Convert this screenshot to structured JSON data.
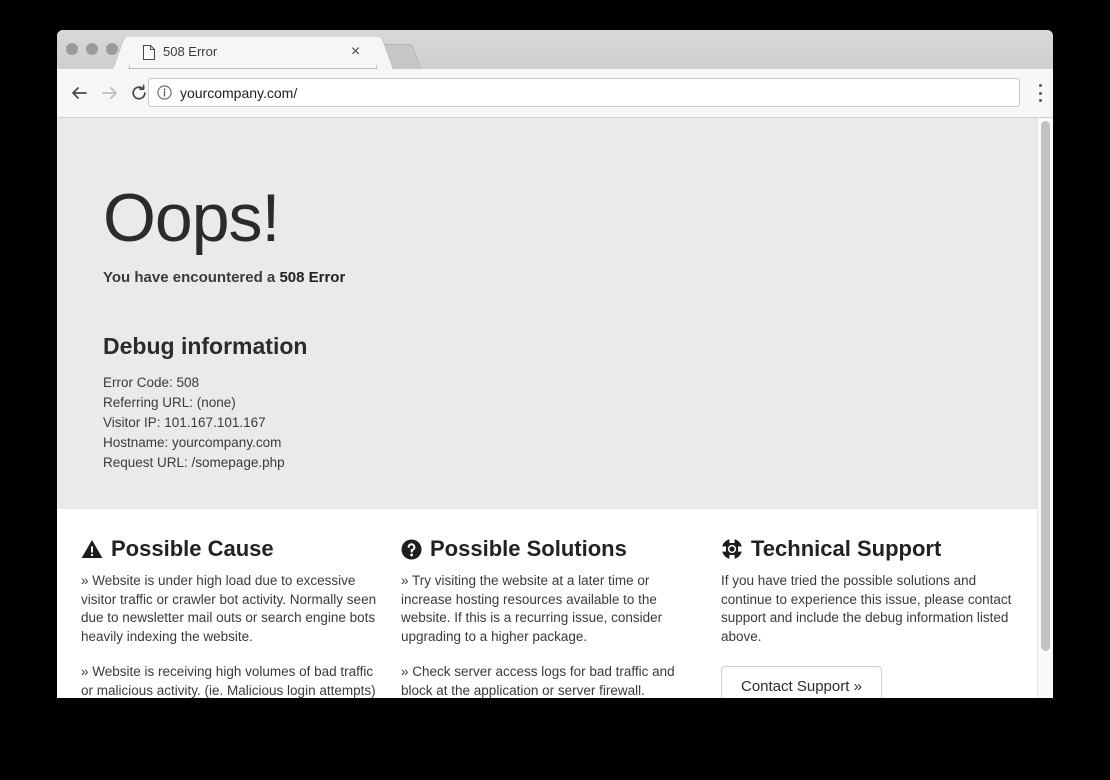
{
  "browser": {
    "tab": {
      "title": "508 Error",
      "favicon": "page-icon",
      "close": "×"
    },
    "toolbar": {
      "back": "back-arrow-icon",
      "forward": "forward-arrow-icon",
      "reload": "reload-icon",
      "security_icon": "info-icon",
      "url": "yourcompany.com/",
      "menu": "three-dot-menu-icon"
    }
  },
  "hero": {
    "title": "Oops!",
    "subtitle_prefix": "You have encountered a ",
    "subtitle_code": "508 Error",
    "debug_heading": "Debug information",
    "debug_lines": [
      "Error Code: 508",
      "Referring URL: (none)",
      "Visitor IP: 101.167.101.167",
      "Hostname: yourcompany.com",
      "Request URL: /somepage.php"
    ]
  },
  "columns": [
    {
      "icon": "warning-triangle-icon",
      "heading": "Possible Cause",
      "paragraphs": [
        "» Website is under high load due to excessive visitor traffic or crawler bot activity. Normally seen due to newsletter mail outs or search engine bots heavily indexing the website.",
        "» Website is receiving high volumes of bad traffic or malicious activity. (ie. Malicious login attempts)"
      ]
    },
    {
      "icon": "question-circle-icon",
      "heading": "Possible Solutions",
      "paragraphs": [
        "» Try visiting the website at a later time or increase hosting resources available to the website. If this is a recurring issue, consider upgrading to a higher package.",
        "» Check server access logs for bad traffic and block at the application or server firewall."
      ]
    },
    {
      "icon": "lifebuoy-icon",
      "heading": "Technical Support",
      "paragraphs": [
        "If you have tried the possible solutions and continue to experience this issue, please contact support and include the debug information listed above."
      ],
      "button_label": "Contact Support »"
    }
  ],
  "colors": {
    "hero_background": "#e9eaeb",
    "page_background": "#ffffff",
    "text": "#3a3a3a",
    "heading": "#222222"
  }
}
